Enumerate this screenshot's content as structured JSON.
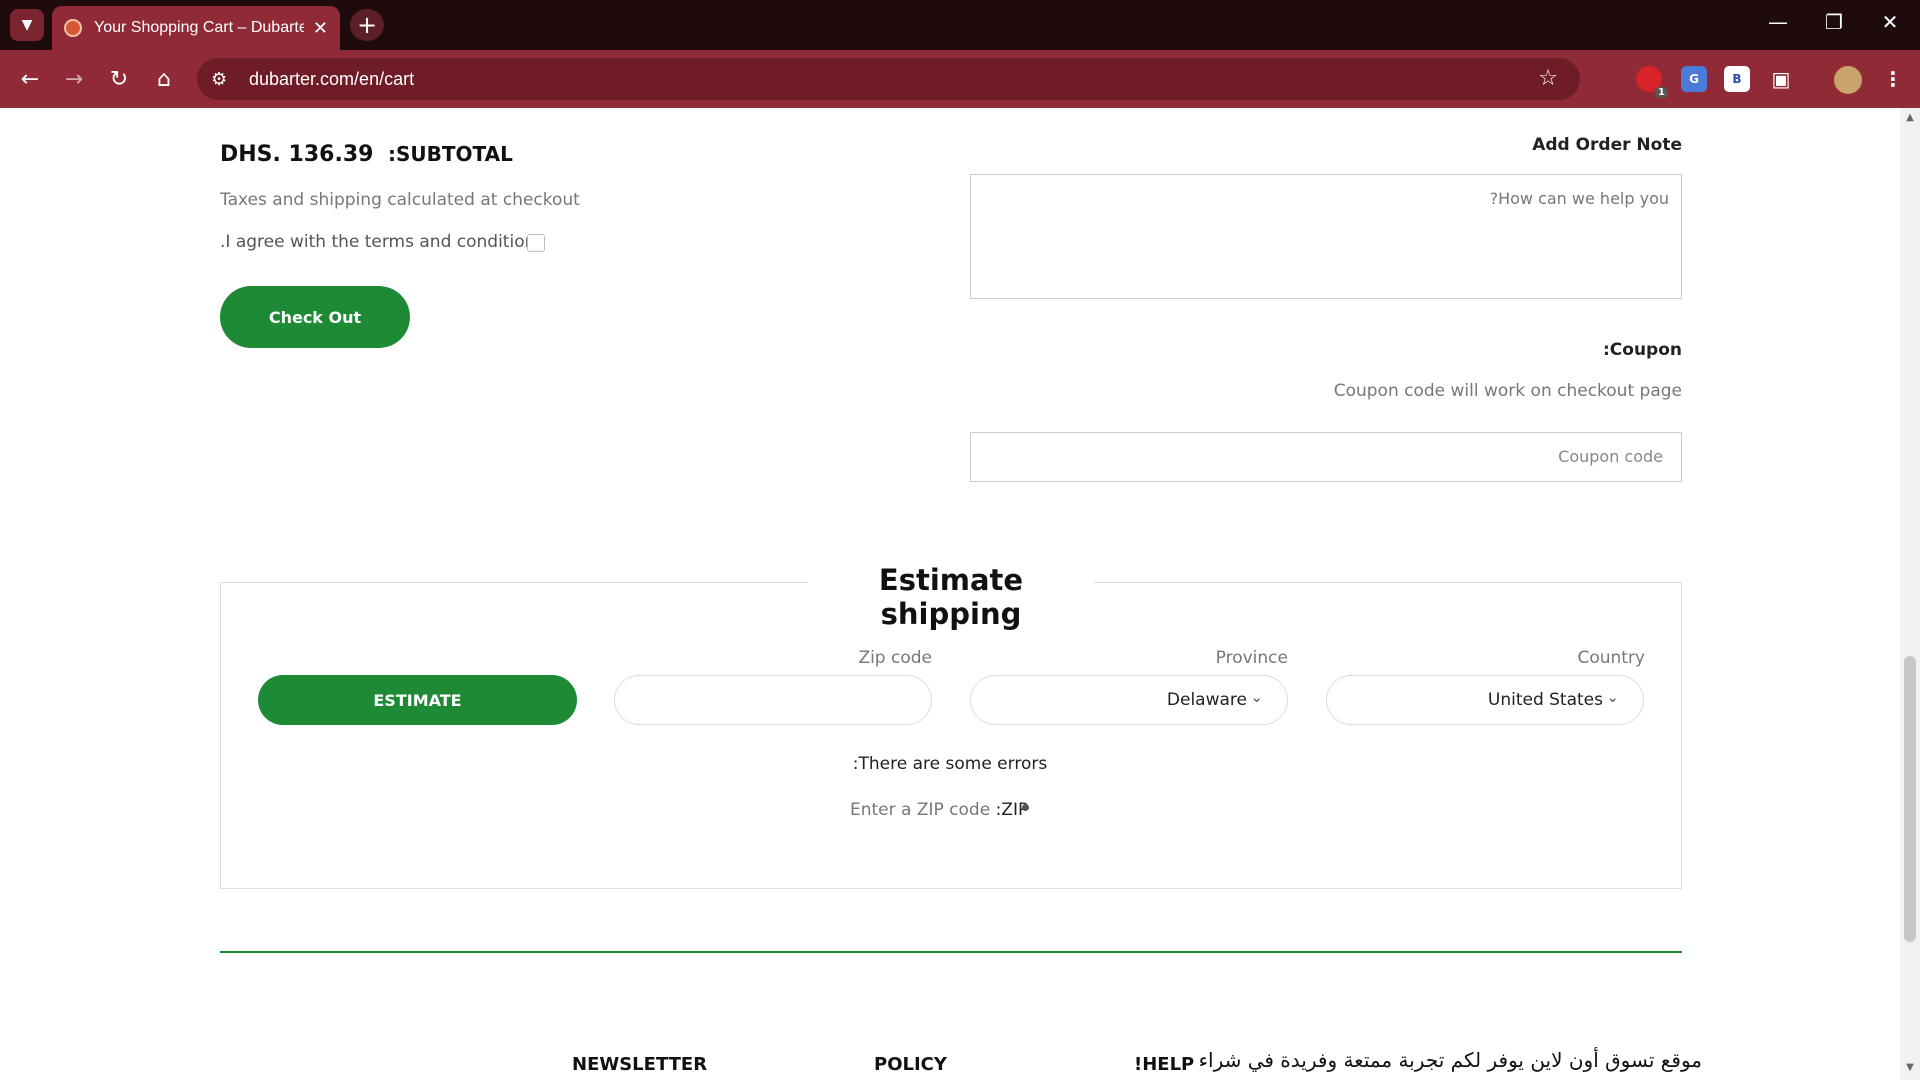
{
  "browser": {
    "tab_title": "Your Shopping Cart – Dubarter",
    "new_tab": "+",
    "url": "dubarter.com/en/cart",
    "extension_badge": "1",
    "ext_b_label": "B"
  },
  "cart": {
    "subtotal_value": "DHS. 136.39",
    "subtotal_label": ":SUBTOTAL",
    "taxes_note": "Taxes and shipping calculated at checkout",
    "terms_label": ".I agree with the terms and conditions",
    "checkout_label": "Check Out",
    "order_note_label": "Add Order Note",
    "order_note_placeholder": "?How can we help you",
    "coupon_label": ":Coupon",
    "coupon_hint": "Coupon code will work on checkout page",
    "coupon_placeholder": "Coupon code"
  },
  "shipping": {
    "title": "Estimate shipping",
    "country_label": "Country",
    "country_value": "United States",
    "province_label": "Province",
    "province_value": "Delaware",
    "zip_label": "Zip code",
    "zip_value": "",
    "estimate_label": "ESTIMATE",
    "errors_title": ":There are some errors",
    "error_message": "Enter a ZIP code",
    "error_field": ":ZIP"
  },
  "footer": {
    "newsletter": "NEWSLETTER",
    "policy": "POLICY",
    "help": "!HELP",
    "about_text": "موقع تسوق أون لاين يوفر لكم تجربة ممتعة وفريدة في شراء"
  },
  "colors": {
    "brand_green": "#1e8a35",
    "chrome_red": "#8f2a36",
    "tabbar_dark": "#1f0a0d"
  }
}
